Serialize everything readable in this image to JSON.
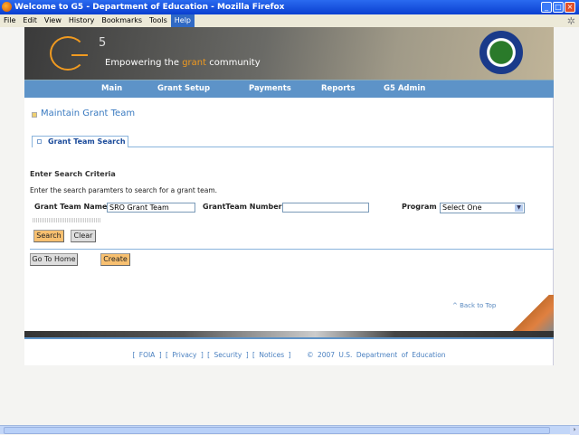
{
  "window": {
    "title": "Welcome to G5 - Department of Education - Mozilla Firefox"
  },
  "menu": [
    "File",
    "Edit",
    "View",
    "History",
    "Bookmarks",
    "Tools",
    "Help"
  ],
  "banner": {
    "logo": "G5",
    "tagline_pre": "Empowering the ",
    "tagline_hl": "grant",
    "tagline_post": " community"
  },
  "nav": [
    "Main",
    "Grant Setup",
    "Payments",
    "Reports",
    "G5 Admin"
  ],
  "page_title": "Maintain Grant Team",
  "tab": "Grant Team Search",
  "criteria": {
    "heading": "Enter Search Criteria",
    "description": "Enter the search paramters to search for a grant team."
  },
  "fields": {
    "name_label": "Grant Team Name",
    "name_value": "SRO Grant Team",
    "number_label": "GrantTeam Number",
    "number_value": "",
    "office_label": "Program Office",
    "office_value": "Select One"
  },
  "buttons": {
    "search": "Search",
    "clear": "Clear",
    "home": "Go To Home",
    "create": "Create"
  },
  "back_to_top": "^ Back to Top",
  "footer": {
    "links": [
      "FOIA",
      "Privacy",
      "Security",
      "Notices"
    ],
    "copyright": "© 2007 U.S. Department of Education"
  },
  "colors": {
    "nav": "#5d93c8",
    "accent": "#f09a20",
    "button": "#f8c070"
  }
}
